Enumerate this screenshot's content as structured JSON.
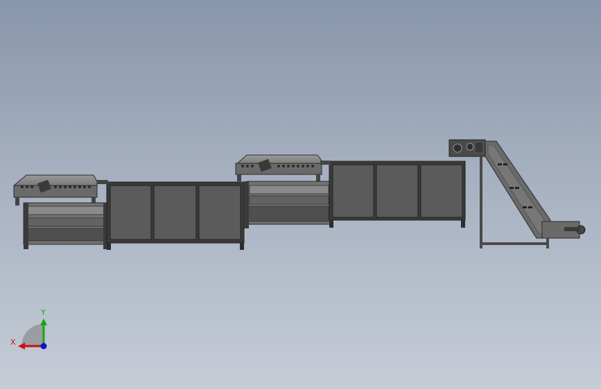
{
  "triad": {
    "x_label": "X",
    "y_label": "Y",
    "x_color": "#cc1111",
    "y_color": "#11aa11",
    "z_color": "#1111cc"
  },
  "colors": {
    "panel_fill": "#5b5b5b",
    "frame_dark": "#2d2d2d",
    "frame_mid": "#6b6b6b",
    "frame_light": "#8a8a8a"
  }
}
